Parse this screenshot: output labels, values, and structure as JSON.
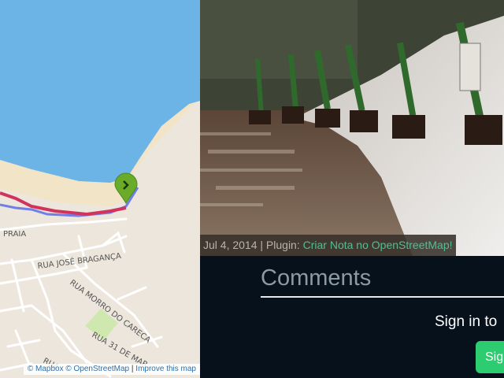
{
  "map": {
    "streets": [
      "PRAIA",
      "RUA JOSÉ BRAGANÇA",
      "RUA MORRO DO CARECA",
      "RUA 31 DE MAR",
      "RUA"
    ],
    "marker_icon": "chevron-right-icon",
    "attribution": {
      "mapbox": "© Mapbox",
      "osm": "© OpenStreetMap",
      "separator": "|",
      "improve": "Improve this map"
    },
    "colors": {
      "water": "#6cb3e6",
      "sand": "#f2e4c6",
      "land": "#ece6dc",
      "road": "#ffffff",
      "park": "#cfe8b0",
      "track": "#d1335d",
      "track_alt": "#6f7fe6",
      "marker": "#6aab2a"
    }
  },
  "photo": {
    "date": "Jul 4, 2014",
    "separator": "|",
    "plugin_prefix": "Plugin:",
    "plugin_link": "Criar Nota no OpenStreetMap!"
  },
  "comments": {
    "title": "Comments",
    "signin_text": "Sign in to",
    "signin_button": "Sign"
  },
  "colors": {
    "page_bg": "#07111b",
    "accent_green": "#2ecc71",
    "link_green": "#4fc08d"
  }
}
